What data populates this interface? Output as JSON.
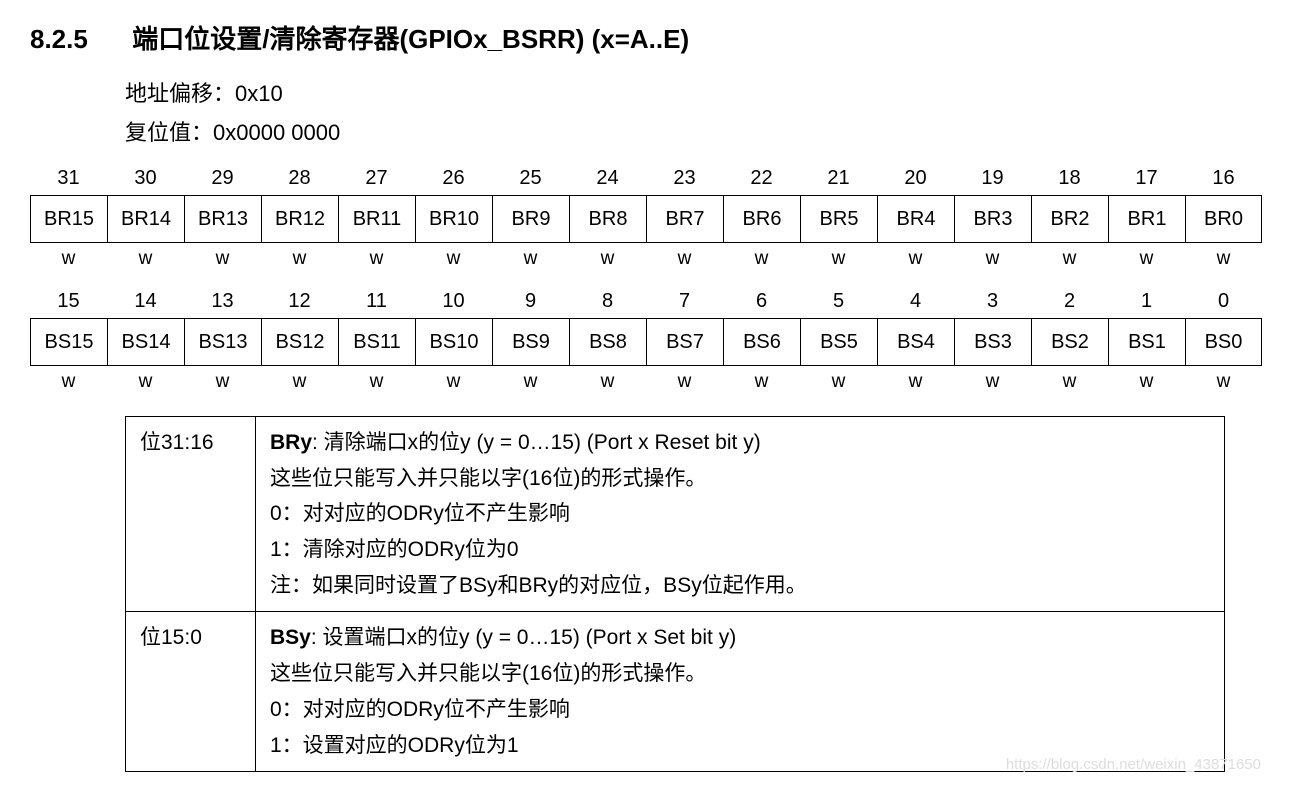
{
  "heading": {
    "number": "8.2.5",
    "title": "端口位设置/清除寄存器(GPIOx_BSRR) (x=A..E)"
  },
  "meta": {
    "addr_label": "地址偏移：",
    "addr_value": "0x10",
    "reset_label": "复位值：",
    "reset_value": "0x0000 0000"
  },
  "high": {
    "nums": [
      "31",
      "30",
      "29",
      "28",
      "27",
      "26",
      "25",
      "24",
      "23",
      "22",
      "21",
      "20",
      "19",
      "18",
      "17",
      "16"
    ],
    "names": [
      "BR15",
      "BR14",
      "BR13",
      "BR12",
      "BR11",
      "BR10",
      "BR9",
      "BR8",
      "BR7",
      "BR6",
      "BR5",
      "BR4",
      "BR3",
      "BR2",
      "BR1",
      "BR0"
    ],
    "access": [
      "w",
      "w",
      "w",
      "w",
      "w",
      "w",
      "w",
      "w",
      "w",
      "w",
      "w",
      "w",
      "w",
      "w",
      "w",
      "w"
    ]
  },
  "low": {
    "nums": [
      "15",
      "14",
      "13",
      "12",
      "11",
      "10",
      "9",
      "8",
      "7",
      "6",
      "5",
      "4",
      "3",
      "2",
      "1",
      "0"
    ],
    "names": [
      "BS15",
      "BS14",
      "BS13",
      "BS12",
      "BS11",
      "BS10",
      "BS9",
      "BS8",
      "BS7",
      "BS6",
      "BS5",
      "BS4",
      "BS3",
      "BS2",
      "BS1",
      "BS0"
    ],
    "access": [
      "w",
      "w",
      "w",
      "w",
      "w",
      "w",
      "w",
      "w",
      "w",
      "w",
      "w",
      "w",
      "w",
      "w",
      "w",
      "w"
    ]
  },
  "desc": {
    "row1": {
      "range": "位31:16",
      "name": "BRy",
      "title": ": 清除端口x的位y (y = 0…15) (Port x Reset bit y)",
      "l1": "这些位只能写入并只能以字(16位)的形式操作。",
      "l2": "0：对对应的ODRy位不产生影响",
      "l3": "1：清除对应的ODRy位为0",
      "l4": "注：如果同时设置了BSy和BRy的对应位，BSy位起作用。"
    },
    "row2": {
      "range": "位15:0",
      "name": "BSy",
      "title": ": 设置端口x的位y (y = 0…15) (Port x Set bit y)",
      "l1": "这些位只能写入并只能以字(16位)的形式操作。",
      "l2": "0：对对应的ODRy位不产生影响",
      "l3": "1：设置对应的ODRy位为1"
    }
  },
  "watermark": "https://blog.csdn.net/weixin_43871650"
}
